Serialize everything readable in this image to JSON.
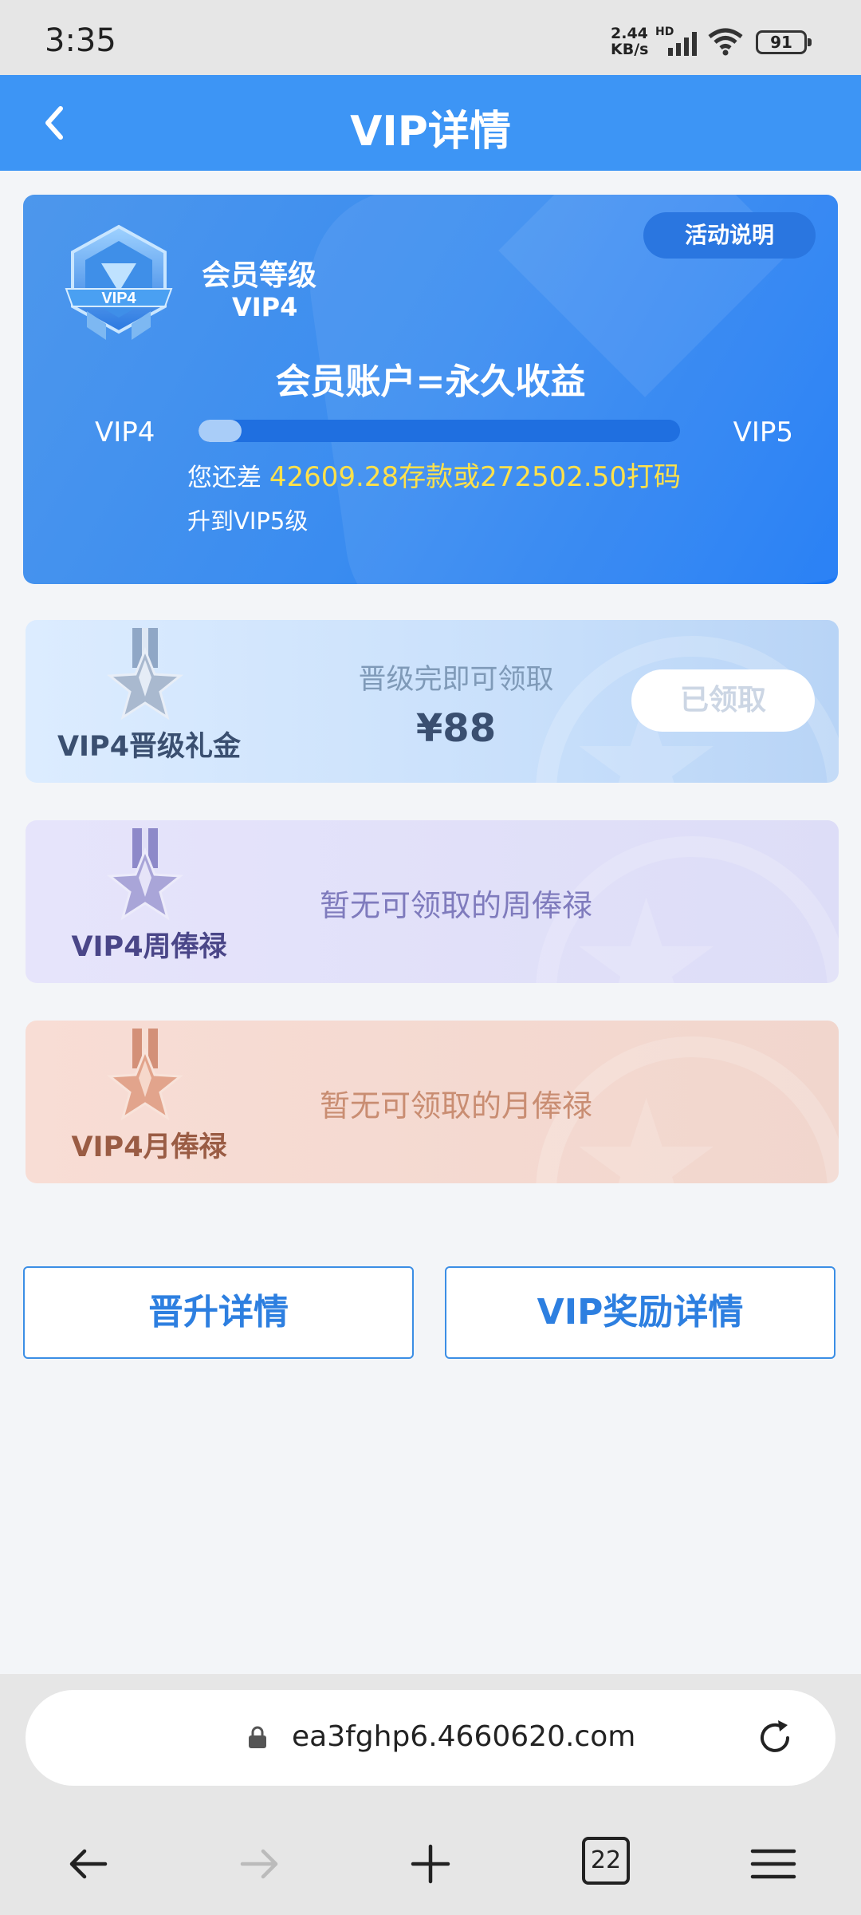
{
  "status_bar": {
    "time": "3:35",
    "net_speed_top": "2.44",
    "net_speed_bottom": "KB/s",
    "hd": "HD",
    "battery": "91"
  },
  "nav": {
    "title": "VIP详情",
    "back_icon": "chevron-left-icon"
  },
  "vip_card": {
    "activity_label": "活动说明",
    "badge_text": "VIP4",
    "level_label": "会员等级",
    "level_value": "VIP4",
    "slogan": "会员账户=永久收益",
    "current_level": "VIP4",
    "next_level": "VIP5",
    "progress": 0.09,
    "need_prefix": "您还差",
    "need_highlight": "42609.28存款或272502.50打码",
    "upgrade_text": "升到VIP5级"
  },
  "rewards": [
    {
      "name": "VIP4晋级礼金",
      "subtitle": "晋级完即可领取",
      "amount": "¥88",
      "button": "已领取",
      "medal_icon": "silver-star-medal-icon"
    },
    {
      "name": "VIP4周俸禄",
      "empty_text": "暂无可领取的周俸禄",
      "medal_icon": "purple-star-medal-icon"
    },
    {
      "name": "VIP4月俸禄",
      "empty_text": "暂无可领取的月俸禄",
      "medal_icon": "bronze-star-medal-icon"
    }
  ],
  "actions": {
    "promotion_details": "晋升详情",
    "vip_reward_details": "VIP奖励详情"
  },
  "browser": {
    "url": "ea3fghp6.4660620.com",
    "tab_count": "22"
  },
  "colors": {
    "nav_blue": "#3d95f5",
    "highlight_yellow": "#ffe14a",
    "button_blue": "#2d7fe0"
  }
}
